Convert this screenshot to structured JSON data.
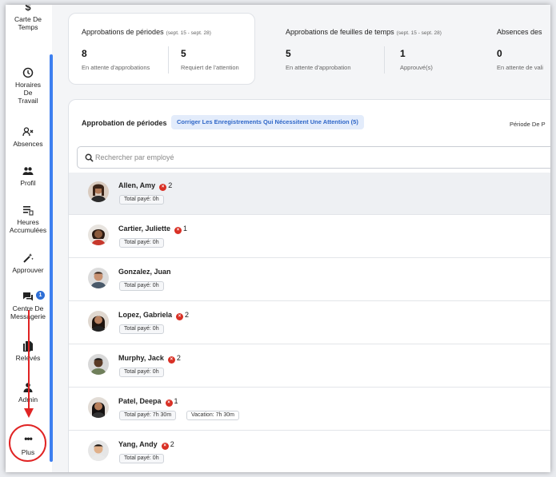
{
  "sidebar": {
    "items": [
      {
        "label": "Carte De Temps",
        "icon": "dollar-icon"
      },
      {
        "label": "Horaires De Travail",
        "icon": "clock-icon"
      },
      {
        "label": "Absences",
        "icon": "person-x-icon"
      },
      {
        "label": "Profil",
        "icon": "people-icon"
      },
      {
        "label": "Heures Accumulées",
        "icon": "list-icon"
      },
      {
        "label": "Approuver",
        "icon": "magic-wand-icon"
      },
      {
        "label": "Centre De Messagerie",
        "icon": "chat-icon",
        "badge": "1"
      },
      {
        "label": "Relevés",
        "icon": "documents-icon"
      },
      {
        "label": "Admin",
        "icon": "person-icon"
      },
      {
        "label": "Plus",
        "icon": "more-dots-icon"
      }
    ]
  },
  "stats": {
    "periods": {
      "title": "Approbations de périodes",
      "range": "(sept. 15 - sept. 28)",
      "pending_value": "8",
      "pending_label": "En attente d'approbations",
      "attention_value": "5",
      "attention_label": "Requiert de l'attention"
    },
    "timesheets": {
      "title": "Approbations de feuilles de temps",
      "range": "(sept. 15 - sept. 28)",
      "pending_value": "5",
      "pending_label": "En attente d'approbation",
      "approved_value": "1",
      "approved_label": "Approuvé(s)"
    },
    "absences": {
      "title": "Absences des",
      "pending_value": "0",
      "pending_label": "En attente de vali"
    }
  },
  "panel": {
    "title": "Approbation de périodes",
    "fix_button": "Corriger Les Enregistrements Qui Nécessitent Une Attention (5)",
    "period_label": "Période De P",
    "search_placeholder": "Rechercher par employé"
  },
  "employees": [
    {
      "name": "Allen, Amy",
      "errors": "2",
      "total": "Total payé: 0h",
      "extra": ""
    },
    {
      "name": "Cartier, Juliette",
      "errors": "1",
      "total": "Total payé: 0h",
      "extra": ""
    },
    {
      "name": "Gonzalez, Juan",
      "errors": "",
      "total": "Total payé: 0h",
      "extra": ""
    },
    {
      "name": "Lopez, Gabriela",
      "errors": "2",
      "total": "Total payé: 0h",
      "extra": ""
    },
    {
      "name": "Murphy, Jack",
      "errors": "2",
      "total": "Total payé: 0h",
      "extra": ""
    },
    {
      "name": "Patel, Deepa",
      "errors": "1",
      "total": "Total payé: 7h 30m",
      "extra": "Vacation: 7h 30m"
    },
    {
      "name": "Yang, Andy",
      "errors": "2",
      "total": "Total payé: 0h",
      "extra": ""
    }
  ],
  "colors": {
    "accent": "#3d7ff0",
    "error": "#d93025",
    "annotation": "#e02424"
  }
}
